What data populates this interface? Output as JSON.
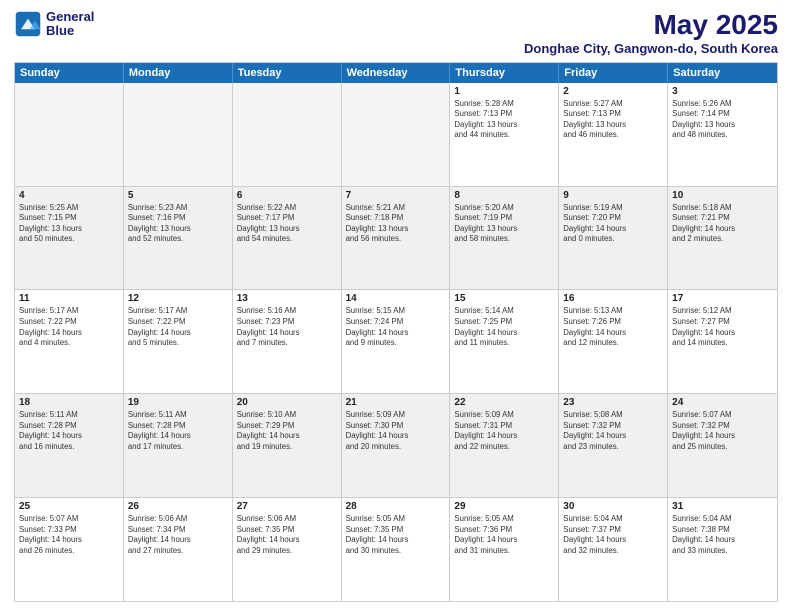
{
  "logo": {
    "line1": "General",
    "line2": "Blue"
  },
  "title": "May 2025",
  "subtitle": "Donghae City, Gangwon-do, South Korea",
  "header_days": [
    "Sunday",
    "Monday",
    "Tuesday",
    "Wednesday",
    "Thursday",
    "Friday",
    "Saturday"
  ],
  "rows": [
    [
      {
        "day": "",
        "lines": [],
        "empty": true
      },
      {
        "day": "",
        "lines": [],
        "empty": true
      },
      {
        "day": "",
        "lines": [],
        "empty": true
      },
      {
        "day": "",
        "lines": [],
        "empty": true
      },
      {
        "day": "1",
        "lines": [
          "Sunrise: 5:28 AM",
          "Sunset: 7:13 PM",
          "Daylight: 13 hours",
          "and 44 minutes."
        ]
      },
      {
        "day": "2",
        "lines": [
          "Sunrise: 5:27 AM",
          "Sunset: 7:13 PM",
          "Daylight: 13 hours",
          "and 46 minutes."
        ]
      },
      {
        "day": "3",
        "lines": [
          "Sunrise: 5:26 AM",
          "Sunset: 7:14 PM",
          "Daylight: 13 hours",
          "and 48 minutes."
        ]
      }
    ],
    [
      {
        "day": "4",
        "lines": [
          "Sunrise: 5:25 AM",
          "Sunset: 7:15 PM",
          "Daylight: 13 hours",
          "and 50 minutes."
        ]
      },
      {
        "day": "5",
        "lines": [
          "Sunrise: 5:23 AM",
          "Sunset: 7:16 PM",
          "Daylight: 13 hours",
          "and 52 minutes."
        ]
      },
      {
        "day": "6",
        "lines": [
          "Sunrise: 5:22 AM",
          "Sunset: 7:17 PM",
          "Daylight: 13 hours",
          "and 54 minutes."
        ]
      },
      {
        "day": "7",
        "lines": [
          "Sunrise: 5:21 AM",
          "Sunset: 7:18 PM",
          "Daylight: 13 hours",
          "and 56 minutes."
        ]
      },
      {
        "day": "8",
        "lines": [
          "Sunrise: 5:20 AM",
          "Sunset: 7:19 PM",
          "Daylight: 13 hours",
          "and 58 minutes."
        ]
      },
      {
        "day": "9",
        "lines": [
          "Sunrise: 5:19 AM",
          "Sunset: 7:20 PM",
          "Daylight: 14 hours",
          "and 0 minutes."
        ]
      },
      {
        "day": "10",
        "lines": [
          "Sunrise: 5:18 AM",
          "Sunset: 7:21 PM",
          "Daylight: 14 hours",
          "and 2 minutes."
        ]
      }
    ],
    [
      {
        "day": "11",
        "lines": [
          "Sunrise: 5:17 AM",
          "Sunset: 7:22 PM",
          "Daylight: 14 hours",
          "and 4 minutes."
        ]
      },
      {
        "day": "12",
        "lines": [
          "Sunrise: 5:17 AM",
          "Sunset: 7:22 PM",
          "Daylight: 14 hours",
          "and 5 minutes."
        ]
      },
      {
        "day": "13",
        "lines": [
          "Sunrise: 5:16 AM",
          "Sunset: 7:23 PM",
          "Daylight: 14 hours",
          "and 7 minutes."
        ]
      },
      {
        "day": "14",
        "lines": [
          "Sunrise: 5:15 AM",
          "Sunset: 7:24 PM",
          "Daylight: 14 hours",
          "and 9 minutes."
        ]
      },
      {
        "day": "15",
        "lines": [
          "Sunrise: 5:14 AM",
          "Sunset: 7:25 PM",
          "Daylight: 14 hours",
          "and 11 minutes."
        ]
      },
      {
        "day": "16",
        "lines": [
          "Sunrise: 5:13 AM",
          "Sunset: 7:26 PM",
          "Daylight: 14 hours",
          "and 12 minutes."
        ]
      },
      {
        "day": "17",
        "lines": [
          "Sunrise: 5:12 AM",
          "Sunset: 7:27 PM",
          "Daylight: 14 hours",
          "and 14 minutes."
        ]
      }
    ],
    [
      {
        "day": "18",
        "lines": [
          "Sunrise: 5:11 AM",
          "Sunset: 7:28 PM",
          "Daylight: 14 hours",
          "and 16 minutes."
        ]
      },
      {
        "day": "19",
        "lines": [
          "Sunrise: 5:11 AM",
          "Sunset: 7:28 PM",
          "Daylight: 14 hours",
          "and 17 minutes."
        ]
      },
      {
        "day": "20",
        "lines": [
          "Sunrise: 5:10 AM",
          "Sunset: 7:29 PM",
          "Daylight: 14 hours",
          "and 19 minutes."
        ]
      },
      {
        "day": "21",
        "lines": [
          "Sunrise: 5:09 AM",
          "Sunset: 7:30 PM",
          "Daylight: 14 hours",
          "and 20 minutes."
        ]
      },
      {
        "day": "22",
        "lines": [
          "Sunrise: 5:09 AM",
          "Sunset: 7:31 PM",
          "Daylight: 14 hours",
          "and 22 minutes."
        ]
      },
      {
        "day": "23",
        "lines": [
          "Sunrise: 5:08 AM",
          "Sunset: 7:32 PM",
          "Daylight: 14 hours",
          "and 23 minutes."
        ]
      },
      {
        "day": "24",
        "lines": [
          "Sunrise: 5:07 AM",
          "Sunset: 7:32 PM",
          "Daylight: 14 hours",
          "and 25 minutes."
        ]
      }
    ],
    [
      {
        "day": "25",
        "lines": [
          "Sunrise: 5:07 AM",
          "Sunset: 7:33 PM",
          "Daylight: 14 hours",
          "and 26 minutes."
        ]
      },
      {
        "day": "26",
        "lines": [
          "Sunrise: 5:06 AM",
          "Sunset: 7:34 PM",
          "Daylight: 14 hours",
          "and 27 minutes."
        ]
      },
      {
        "day": "27",
        "lines": [
          "Sunrise: 5:06 AM",
          "Sunset: 7:35 PM",
          "Daylight: 14 hours",
          "and 29 minutes."
        ]
      },
      {
        "day": "28",
        "lines": [
          "Sunrise: 5:05 AM",
          "Sunset: 7:35 PM",
          "Daylight: 14 hours",
          "and 30 minutes."
        ]
      },
      {
        "day": "29",
        "lines": [
          "Sunrise: 5:05 AM",
          "Sunset: 7:36 PM",
          "Daylight: 14 hours",
          "and 31 minutes."
        ]
      },
      {
        "day": "30",
        "lines": [
          "Sunrise: 5:04 AM",
          "Sunset: 7:37 PM",
          "Daylight: 14 hours",
          "and 32 minutes."
        ]
      },
      {
        "day": "31",
        "lines": [
          "Sunrise: 5:04 AM",
          "Sunset: 7:38 PM",
          "Daylight: 14 hours",
          "and 33 minutes."
        ]
      }
    ]
  ]
}
